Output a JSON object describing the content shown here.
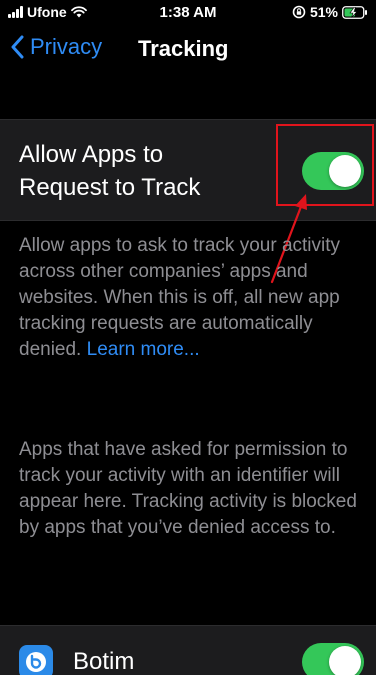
{
  "status_bar": {
    "carrier": "Ufone",
    "time": "1:38 AM",
    "battery": "51%"
  },
  "nav": {
    "back_label": "Privacy",
    "title": "Tracking"
  },
  "tracking_toggle": {
    "label": "Allow Apps to Request to Track",
    "on": true,
    "on_color": "#34c759"
  },
  "footer": {
    "description": "Allow apps to ask to track your activity across other companies’ apps and websites. When this is off, all new app tracking requests are automatically denied.",
    "learn_more": "Learn more...",
    "apps_info": "Apps that have asked for permission to track your activity with an identifier will appear here. Tracking activity is blocked by apps that you’ve denied access to."
  },
  "apps": [
    {
      "name": "Botim",
      "on": true,
      "icon": "botim-icon"
    }
  ],
  "annotation": {
    "color": "#e1141c"
  },
  "colors": {
    "accent": "#2f8cf5",
    "background": "#000000",
    "cell": "#1c1c1e",
    "secondary_text": "#8e8e93"
  }
}
